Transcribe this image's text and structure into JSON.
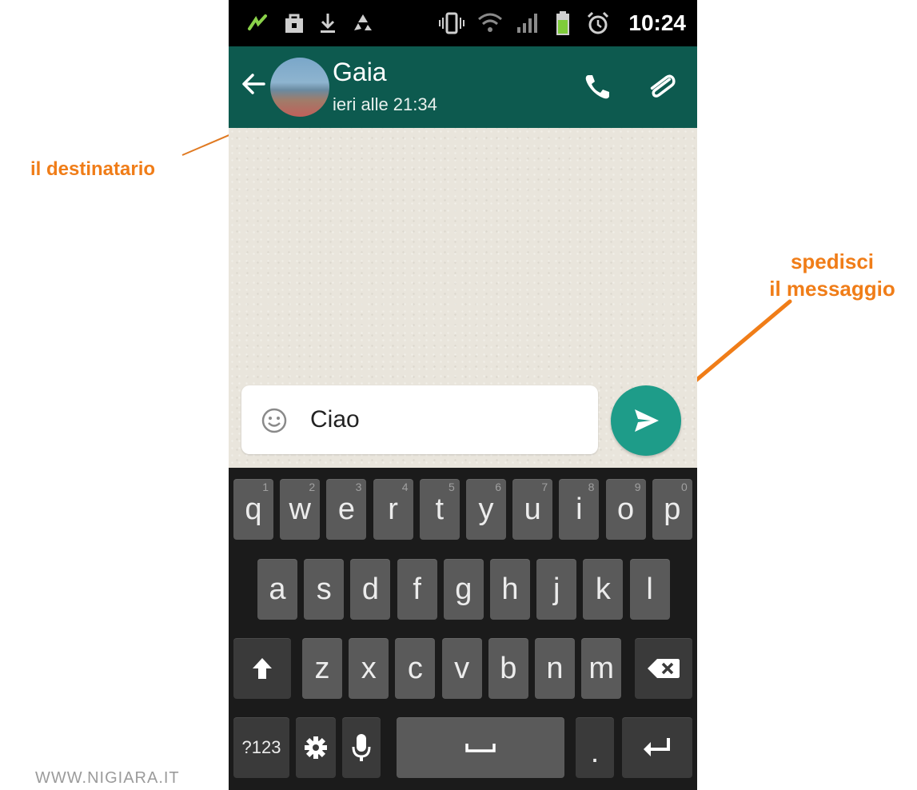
{
  "status_bar": {
    "time": "10:24",
    "icons": [
      "signal-activity-icon",
      "shopping-bag-icon",
      "download-icon",
      "recycle-icon",
      "vibrate-icon",
      "wifi-icon",
      "cell-signal-icon",
      "battery-icon",
      "alarm-clock-icon"
    ]
  },
  "app_bar": {
    "contact_name": "Gaia",
    "last_seen": "ieri alle 21:34",
    "colors": {
      "header": "#0d5a4f",
      "accent": "#1e9c89"
    }
  },
  "composer": {
    "message_value": "Ciao"
  },
  "keyboard": {
    "row1": [
      {
        "key": "q",
        "num": "1"
      },
      {
        "key": "w",
        "num": "2"
      },
      {
        "key": "e",
        "num": "3"
      },
      {
        "key": "r",
        "num": "4"
      },
      {
        "key": "t",
        "num": "5"
      },
      {
        "key": "y",
        "num": "6"
      },
      {
        "key": "u",
        "num": "7"
      },
      {
        "key": "i",
        "num": "8"
      },
      {
        "key": "o",
        "num": "9"
      },
      {
        "key": "p",
        "num": "0"
      }
    ],
    "row2": [
      "a",
      "s",
      "d",
      "f",
      "g",
      "h",
      "j",
      "k",
      "l"
    ],
    "row3": [
      "z",
      "x",
      "c",
      "v",
      "b",
      "n",
      "m"
    ],
    "symbols_label": "?123",
    "period_label": "."
  },
  "annotations": {
    "recipient": "il destinatario",
    "send_line1": "spedisci",
    "send_line2": "il messaggio",
    "color": "#f07d18"
  },
  "watermark": "WWW.NIGIARA.IT"
}
